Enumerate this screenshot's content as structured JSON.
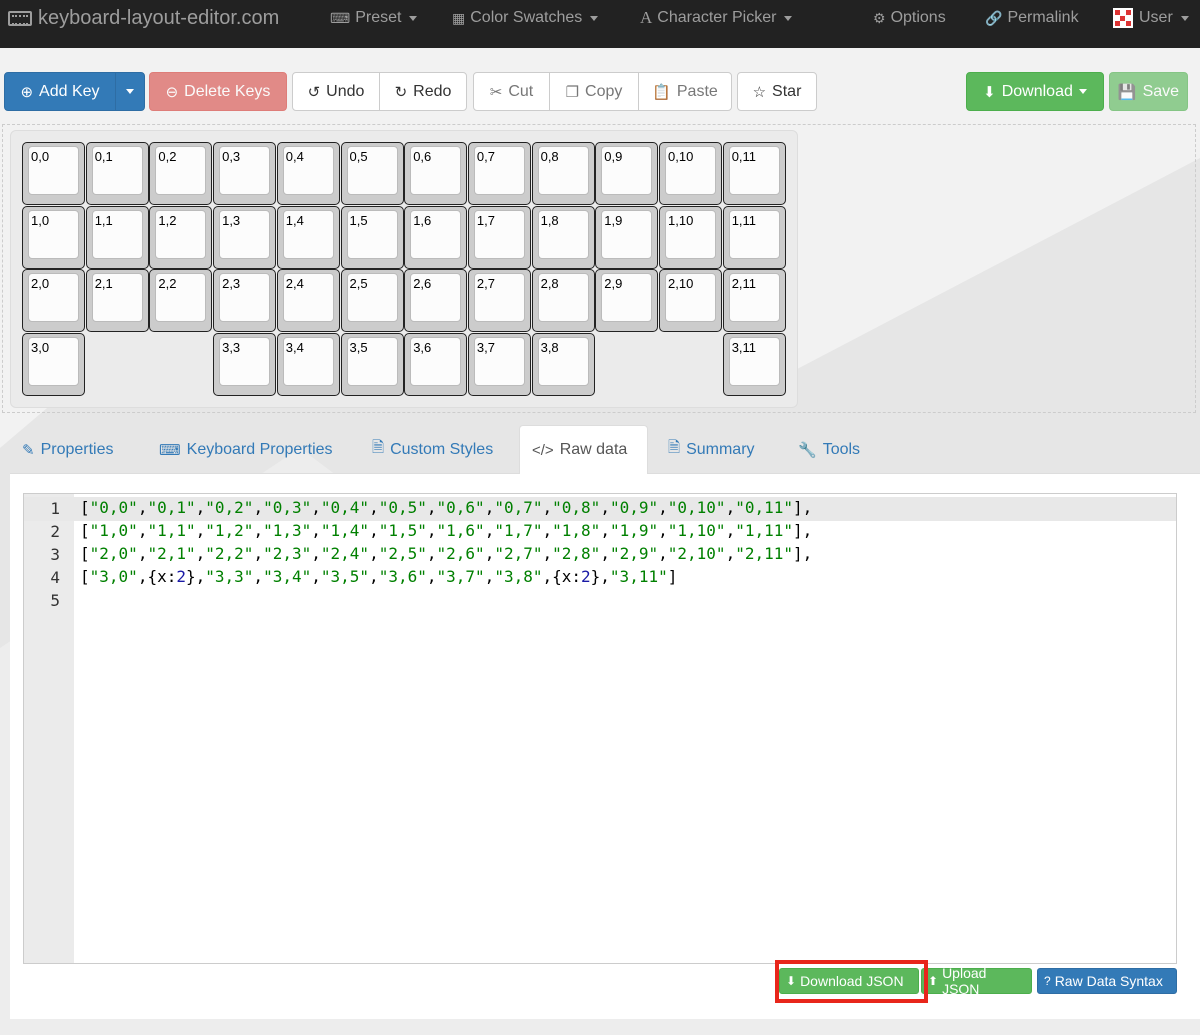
{
  "navbar": {
    "brand": "keyboard-layout-editor.com",
    "preset": "Preset",
    "color_swatches": "Color Swatches",
    "character_picker": "Character Picker",
    "options": "Options",
    "permalink": "Permalink",
    "user": "User"
  },
  "toolbar": {
    "add_key": "Add Key",
    "delete_keys": "Delete Keys",
    "undo": "Undo",
    "redo": "Redo",
    "cut": "Cut",
    "copy": "Copy",
    "paste": "Paste",
    "star": "Star",
    "download": "Download",
    "save": "Save"
  },
  "keyboard": {
    "row0": [
      "0,0",
      "0,1",
      "0,2",
      "0,3",
      "0,4",
      "0,5",
      "0,6",
      "0,7",
      "0,8",
      "0,9",
      "0,10",
      "0,11"
    ],
    "row1": [
      "1,0",
      "1,1",
      "1,2",
      "1,3",
      "1,4",
      "1,5",
      "1,6",
      "1,7",
      "1,8",
      "1,9",
      "1,10",
      "1,11"
    ],
    "row2": [
      "2,0",
      "2,1",
      "2,2",
      "2,3",
      "2,4",
      "2,5",
      "2,6",
      "2,7",
      "2,8",
      "2,9",
      "2,10",
      "2,11"
    ],
    "row3": [
      "3,0",
      "3,3",
      "3,4",
      "3,5",
      "3,6",
      "3,7",
      "3,8",
      "3,11"
    ]
  },
  "tabs": {
    "properties": "Properties",
    "keyboard_properties": "Keyboard Properties",
    "custom_styles": "Custom Styles",
    "raw_data": "Raw data",
    "summary": "Summary",
    "tools": "Tools"
  },
  "editor": {
    "line_numbers": [
      "1",
      "2",
      "3",
      "4",
      "5"
    ]
  },
  "actions": {
    "download_json": "Download JSON",
    "upload_json": "Upload JSON",
    "raw_data_syntax": "Raw Data Syntax"
  },
  "colors": {
    "navbar_bg": "#222222",
    "primary": "#337ab7",
    "success": "#5cb85c",
    "danger": "#d9534f",
    "highlight": "#e8261b"
  }
}
